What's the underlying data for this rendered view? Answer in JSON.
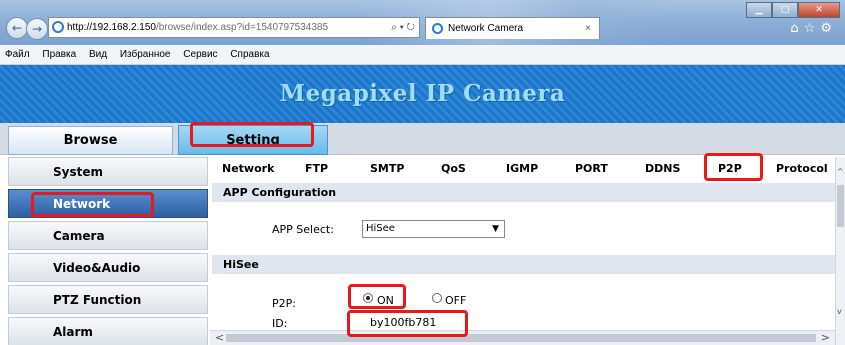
{
  "browser": {
    "url_host": "http://192.168.2.150",
    "url_path": "/browse/index.asp?id=1540797534385",
    "address_controls": "⌕ ▾ ↻",
    "tab_title": "Network Camera",
    "tab_close": "×",
    "menu": [
      "Файл",
      "Правка",
      "Вид",
      "Избранное",
      "Сервис",
      "Справка"
    ]
  },
  "page": {
    "banner_title": "Megapixel IP Camera",
    "top_tabs": {
      "browse": "Browse",
      "setting": "Setting"
    },
    "sidebar": [
      {
        "label": "System",
        "active": false
      },
      {
        "label": "Network",
        "active": true
      },
      {
        "label": "Camera",
        "active": false
      },
      {
        "label": "Video&Audio",
        "active": false
      },
      {
        "label": "PTZ Function",
        "active": false
      },
      {
        "label": "Alarm",
        "active": false
      }
    ],
    "subtabs": [
      "Network",
      "FTP",
      "SMTP",
      "QoS",
      "IGMP",
      "PORT",
      "DDNS",
      "P2P",
      "Protocol"
    ],
    "selected_subtab": "P2P",
    "app_config": {
      "section_title": "APP Configuration",
      "app_select_label": "APP Select:",
      "app_select_value": "HiSee"
    },
    "hisee": {
      "section_title": "HiSee",
      "p2p_label": "P2P:",
      "p2p_on_label": "ON",
      "p2p_off_label": "OFF",
      "p2p_state": "ON",
      "id_label": "ID:",
      "id_value": "by100fb781"
    }
  },
  "colors": {
    "highlight": "#e8191c",
    "banner_blue": "#2a86d8",
    "banner_text": "#9edcf8",
    "setting_tab": "#69b9ea",
    "active_sidebar": "#2d5fa2"
  }
}
